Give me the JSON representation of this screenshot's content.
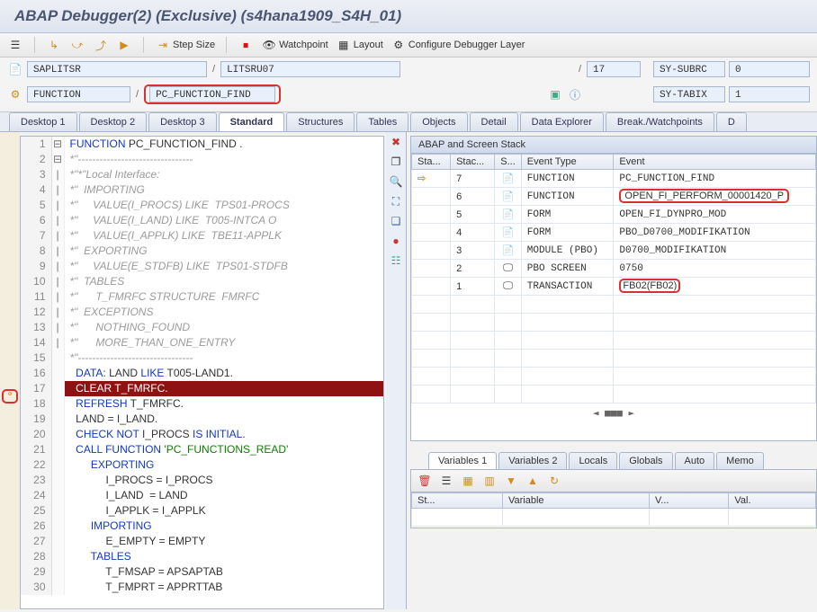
{
  "title": "ABAP Debugger(2)  (Exclusive) (s4hana1909_S4H_01)",
  "toolbar": {
    "step_size": "Step Size",
    "watchpoint": "Watchpoint",
    "layout": "Layout",
    "configure": "Configure Debugger Layer"
  },
  "context": {
    "row1": {
      "program": "SAPLITSR",
      "include": "LITSRU07",
      "line": "17",
      "sy_subrc_label": "SY-SUBRC",
      "sy_subrc_val": "0"
    },
    "row2": {
      "type": "FUNCTION",
      "name": "PC_FUNCTION_FIND",
      "sy_tabix_label": "SY-TABIX",
      "sy_tabix_val": "1"
    }
  },
  "tabs": [
    "Desktop 1",
    "Desktop 2",
    "Desktop 3",
    "Standard",
    "Structures",
    "Tables",
    "Objects",
    "Detail",
    "Data Explorer",
    "Break./Watchpoints",
    "D"
  ],
  "active_tab": "Standard",
  "code": [
    {
      "n": 1,
      "f": "⊟",
      "cls": "",
      "html": "<span class='kw'>FUNCTION</span> PC_FUNCTION_FIND ."
    },
    {
      "n": 2,
      "f": "⊟",
      "cls": "cm",
      "html": "*\"--------------------------------"
    },
    {
      "n": 3,
      "f": "|",
      "cls": "cm",
      "html": "*\"*\"Local Interface:"
    },
    {
      "n": 4,
      "f": "|",
      "cls": "cm",
      "html": "*\"  IMPORTING"
    },
    {
      "n": 5,
      "f": "|",
      "cls": "cm",
      "html": "*\"     VALUE(I_PROCS) LIKE  TPS01-PROCS"
    },
    {
      "n": 6,
      "f": "|",
      "cls": "cm",
      "html": "*\"     VALUE(I_LAND) LIKE  T005-INTCA O"
    },
    {
      "n": 7,
      "f": "|",
      "cls": "cm",
      "html": "*\"     VALUE(I_APPLK) LIKE  TBE11-APPLK"
    },
    {
      "n": 8,
      "f": "|",
      "cls": "cm",
      "html": "*\"  EXPORTING"
    },
    {
      "n": 9,
      "f": "|",
      "cls": "cm",
      "html": "*\"     VALUE(E_STDFB) LIKE  TPS01-STDFB"
    },
    {
      "n": 10,
      "f": "|",
      "cls": "cm",
      "html": "*\"  TABLES"
    },
    {
      "n": 11,
      "f": "|",
      "cls": "cm",
      "html": "*\"      T_FMRFC STRUCTURE  FMRFC"
    },
    {
      "n": 12,
      "f": "|",
      "cls": "cm",
      "html": "*\"  EXCEPTIONS"
    },
    {
      "n": 13,
      "f": "|",
      "cls": "cm",
      "html": "*\"      NOTHING_FOUND"
    },
    {
      "n": 14,
      "f": "|",
      "cls": "cm",
      "html": "*\"      MORE_THAN_ONE_ENTRY"
    },
    {
      "n": 15,
      "f": "",
      "cls": "cm",
      "html": "*\"--------------------------------"
    },
    {
      "n": 16,
      "f": "",
      "cls": "",
      "html": "  <span class='kw'>DATA</span>: LAND <span class='kw'>LIKE</span> T005-LAND1."
    },
    {
      "n": 17,
      "f": "",
      "cls": "cur",
      "html": "  <span class='kw'>CLEAR</span> T_FMRFC."
    },
    {
      "n": 18,
      "f": "",
      "cls": "",
      "html": "  <span class='kw'>REFRESH</span> T_FMRFC."
    },
    {
      "n": 19,
      "f": "",
      "cls": "",
      "html": "  LAND = I_LAND."
    },
    {
      "n": 20,
      "f": "",
      "cls": "",
      "html": "  <span class='kw'>CHECK NOT</span> I_PROCS <span class='kw'>IS INITIAL</span>."
    },
    {
      "n": 21,
      "f": "",
      "cls": "",
      "html": "  <span class='kw'>CALL FUNCTION</span> <span class='st'>'PC_FUNCTIONS_READ'</span>"
    },
    {
      "n": 22,
      "f": "",
      "cls": "",
      "html": "       <span class='kw'>EXPORTING</span>"
    },
    {
      "n": 23,
      "f": "",
      "cls": "",
      "html": "            I_PROCS = I_PROCS"
    },
    {
      "n": 24,
      "f": "",
      "cls": "",
      "html": "            I_LAND  = LAND"
    },
    {
      "n": 25,
      "f": "",
      "cls": "",
      "html": "            I_APPLK = I_APPLK"
    },
    {
      "n": 26,
      "f": "",
      "cls": "",
      "html": "       <span class='kw'>IMPORTING</span>"
    },
    {
      "n": 27,
      "f": "",
      "cls": "",
      "html": "            E_EMPTY = EMPTY"
    },
    {
      "n": 28,
      "f": "",
      "cls": "",
      "html": "       <span class='kw'>TABLES</span>"
    },
    {
      "n": 29,
      "f": "",
      "cls": "",
      "html": "            T_FMSAP = APSAPTAB"
    },
    {
      "n": 30,
      "f": "",
      "cls": "",
      "html": "            T_FMPRT = APPRTTAB"
    }
  ],
  "stack": {
    "title": "ABAP and Screen Stack",
    "headers": [
      "Sta...",
      "Stac...",
      "S...",
      "Event Type",
      "Event"
    ],
    "rows": [
      {
        "arrow": "⇨",
        "lvl": "7",
        "icon": "📄",
        "type": "FUNCTION",
        "event": "PC_FUNCTION_FIND",
        "hl": false
      },
      {
        "arrow": "",
        "lvl": "6",
        "icon": "📄",
        "type": "FUNCTION",
        "event": "OPEN_FI_PERFORM_00001420_P",
        "hl": true
      },
      {
        "arrow": "",
        "lvl": "5",
        "icon": "📄",
        "type": "FORM",
        "event": "OPEN_FI_DYNPRO_MOD",
        "hl": false
      },
      {
        "arrow": "",
        "lvl": "4",
        "icon": "📄",
        "type": "FORM",
        "event": "PBO_D0700_MODIFIKATION",
        "hl": false
      },
      {
        "arrow": "",
        "lvl": "3",
        "icon": "📄",
        "type": "MODULE (PBO)",
        "event": "D0700_MODIFIKATION",
        "hl": false
      },
      {
        "arrow": "",
        "lvl": "2",
        "icon": "🖵",
        "type": "PBO SCREEN",
        "event": "0750",
        "hl": false
      },
      {
        "arrow": "",
        "lvl": "1",
        "icon": "🖵",
        "type": "TRANSACTION",
        "event": "FB02(FB02)",
        "hl": "small"
      }
    ]
  },
  "var_tabs": [
    "Variables 1",
    "Variables 2",
    "Locals",
    "Globals",
    "Auto",
    "Memo"
  ],
  "var_tab_active": "Variables 1",
  "var_headers": [
    "St...",
    "Variable",
    "V...",
    "Val."
  ]
}
